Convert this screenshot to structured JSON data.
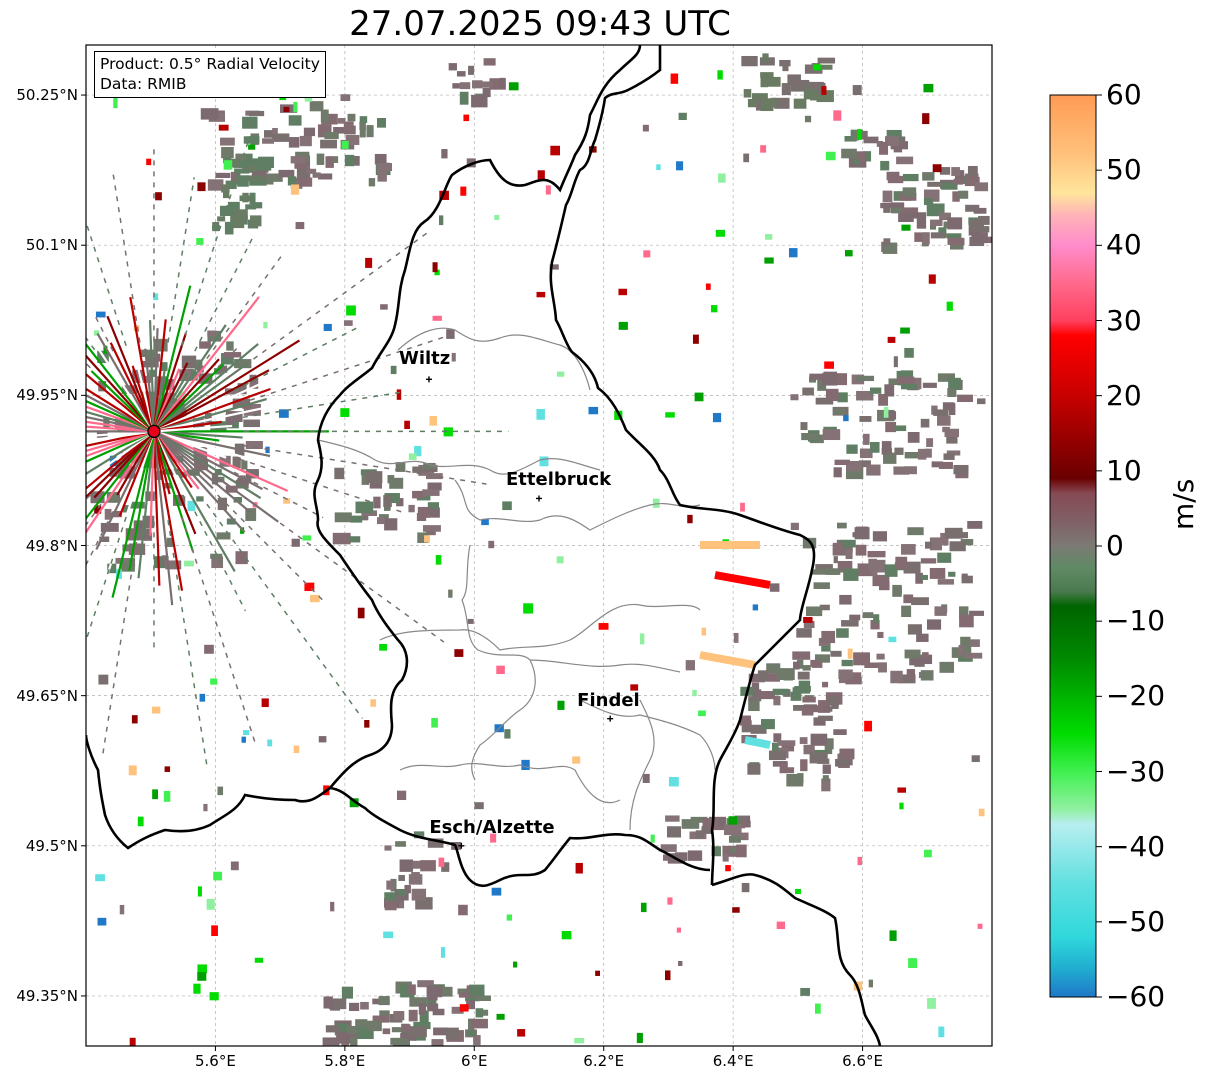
{
  "title": "27.07.2025 09:43 UTC",
  "info": {
    "product": "Product: 0.5° Radial Velocity",
    "data": "Data: RMIB"
  },
  "map": {
    "lon_range": [
      5.4,
      6.8
    ],
    "lat_range": [
      49.3,
      50.3
    ],
    "lat_ticks": [
      {
        "value": 50.25,
        "label": "50.25°N"
      },
      {
        "value": 50.1,
        "label": "50.1°N"
      },
      {
        "value": 49.95,
        "label": "49.95°N"
      },
      {
        "value": 49.8,
        "label": "49.8°N"
      },
      {
        "value": 49.65,
        "label": "49.65°N"
      },
      {
        "value": 49.5,
        "label": "49.5°N"
      },
      {
        "value": 49.35,
        "label": "49.35°N"
      }
    ],
    "lon_ticks": [
      {
        "value": 5.6,
        "label": "5.6°E"
      },
      {
        "value": 5.8,
        "label": "5.8°E"
      },
      {
        "value": 6.0,
        "label": "6°E"
      },
      {
        "value": 6.2,
        "label": "6.2°E"
      },
      {
        "value": 6.4,
        "label": "6.4°E"
      },
      {
        "value": 6.6,
        "label": "6.6°E"
      }
    ],
    "grid": true,
    "radar_site": {
      "lon": 5.505,
      "lat": 49.914,
      "color": "#e8001a"
    },
    "cities": [
      {
        "name": "Wiltz",
        "lon": 5.93,
        "lat": 49.966
      },
      {
        "name": "Ettelbruck",
        "lon": 6.1,
        "lat": 49.847
      },
      {
        "name": "Findel",
        "lon": 6.21,
        "lat": 49.627
      },
      {
        "name": "Esch/Alzette",
        "lon": 5.98,
        "lat": 49.5
      }
    ]
  },
  "colorbar": {
    "label": "m/s",
    "min": -60,
    "max": 60,
    "ticks": [
      {
        "value": 60,
        "label": "60"
      },
      {
        "value": 50,
        "label": "50"
      },
      {
        "value": 40,
        "label": "40"
      },
      {
        "value": 30,
        "label": "30"
      },
      {
        "value": 20,
        "label": "20"
      },
      {
        "value": 10,
        "label": "10"
      },
      {
        "value": 0,
        "label": "0"
      },
      {
        "value": -10,
        "label": "−10"
      },
      {
        "value": -20,
        "label": "−20"
      },
      {
        "value": -30,
        "label": "−30"
      },
      {
        "value": -40,
        "label": "−40"
      },
      {
        "value": -50,
        "label": "−50"
      },
      {
        "value": -60,
        "label": "−60"
      }
    ],
    "stops": [
      {
        "value": 60,
        "color": "#ff9b55"
      },
      {
        "value": 52,
        "color": "#ffc27c"
      },
      {
        "value": 47,
        "color": "#ffe59c"
      },
      {
        "value": 44,
        "color": "#ffb3b8"
      },
      {
        "value": 40,
        "color": "#ff8ccb"
      },
      {
        "value": 35,
        "color": "#ff6a8c"
      },
      {
        "value": 30,
        "color": "#ff4060"
      },
      {
        "value": 28,
        "color": "#ff0000"
      },
      {
        "value": 20,
        "color": "#c80000"
      },
      {
        "value": 13,
        "color": "#8c0000"
      },
      {
        "value": 9,
        "color": "#6a0000"
      },
      {
        "value": 7,
        "color": "#864a54"
      },
      {
        "value": 3,
        "color": "#806268"
      },
      {
        "value": 0,
        "color": "#7c7a74"
      },
      {
        "value": -3,
        "color": "#5f8a64"
      },
      {
        "value": -6,
        "color": "#4c7a50"
      },
      {
        "value": -8,
        "color": "#006400"
      },
      {
        "value": -15,
        "color": "#008a00"
      },
      {
        "value": -25,
        "color": "#00dc00"
      },
      {
        "value": -30,
        "color": "#40f050"
      },
      {
        "value": -35,
        "color": "#90f0a0"
      },
      {
        "value": -37,
        "color": "#b8eef0"
      },
      {
        "value": -45,
        "color": "#60e0e0"
      },
      {
        "value": -52,
        "color": "#30d8dc"
      },
      {
        "value": -56,
        "color": "#20b0d0"
      },
      {
        "value": -60,
        "color": "#1f78c8"
      }
    ]
  }
}
